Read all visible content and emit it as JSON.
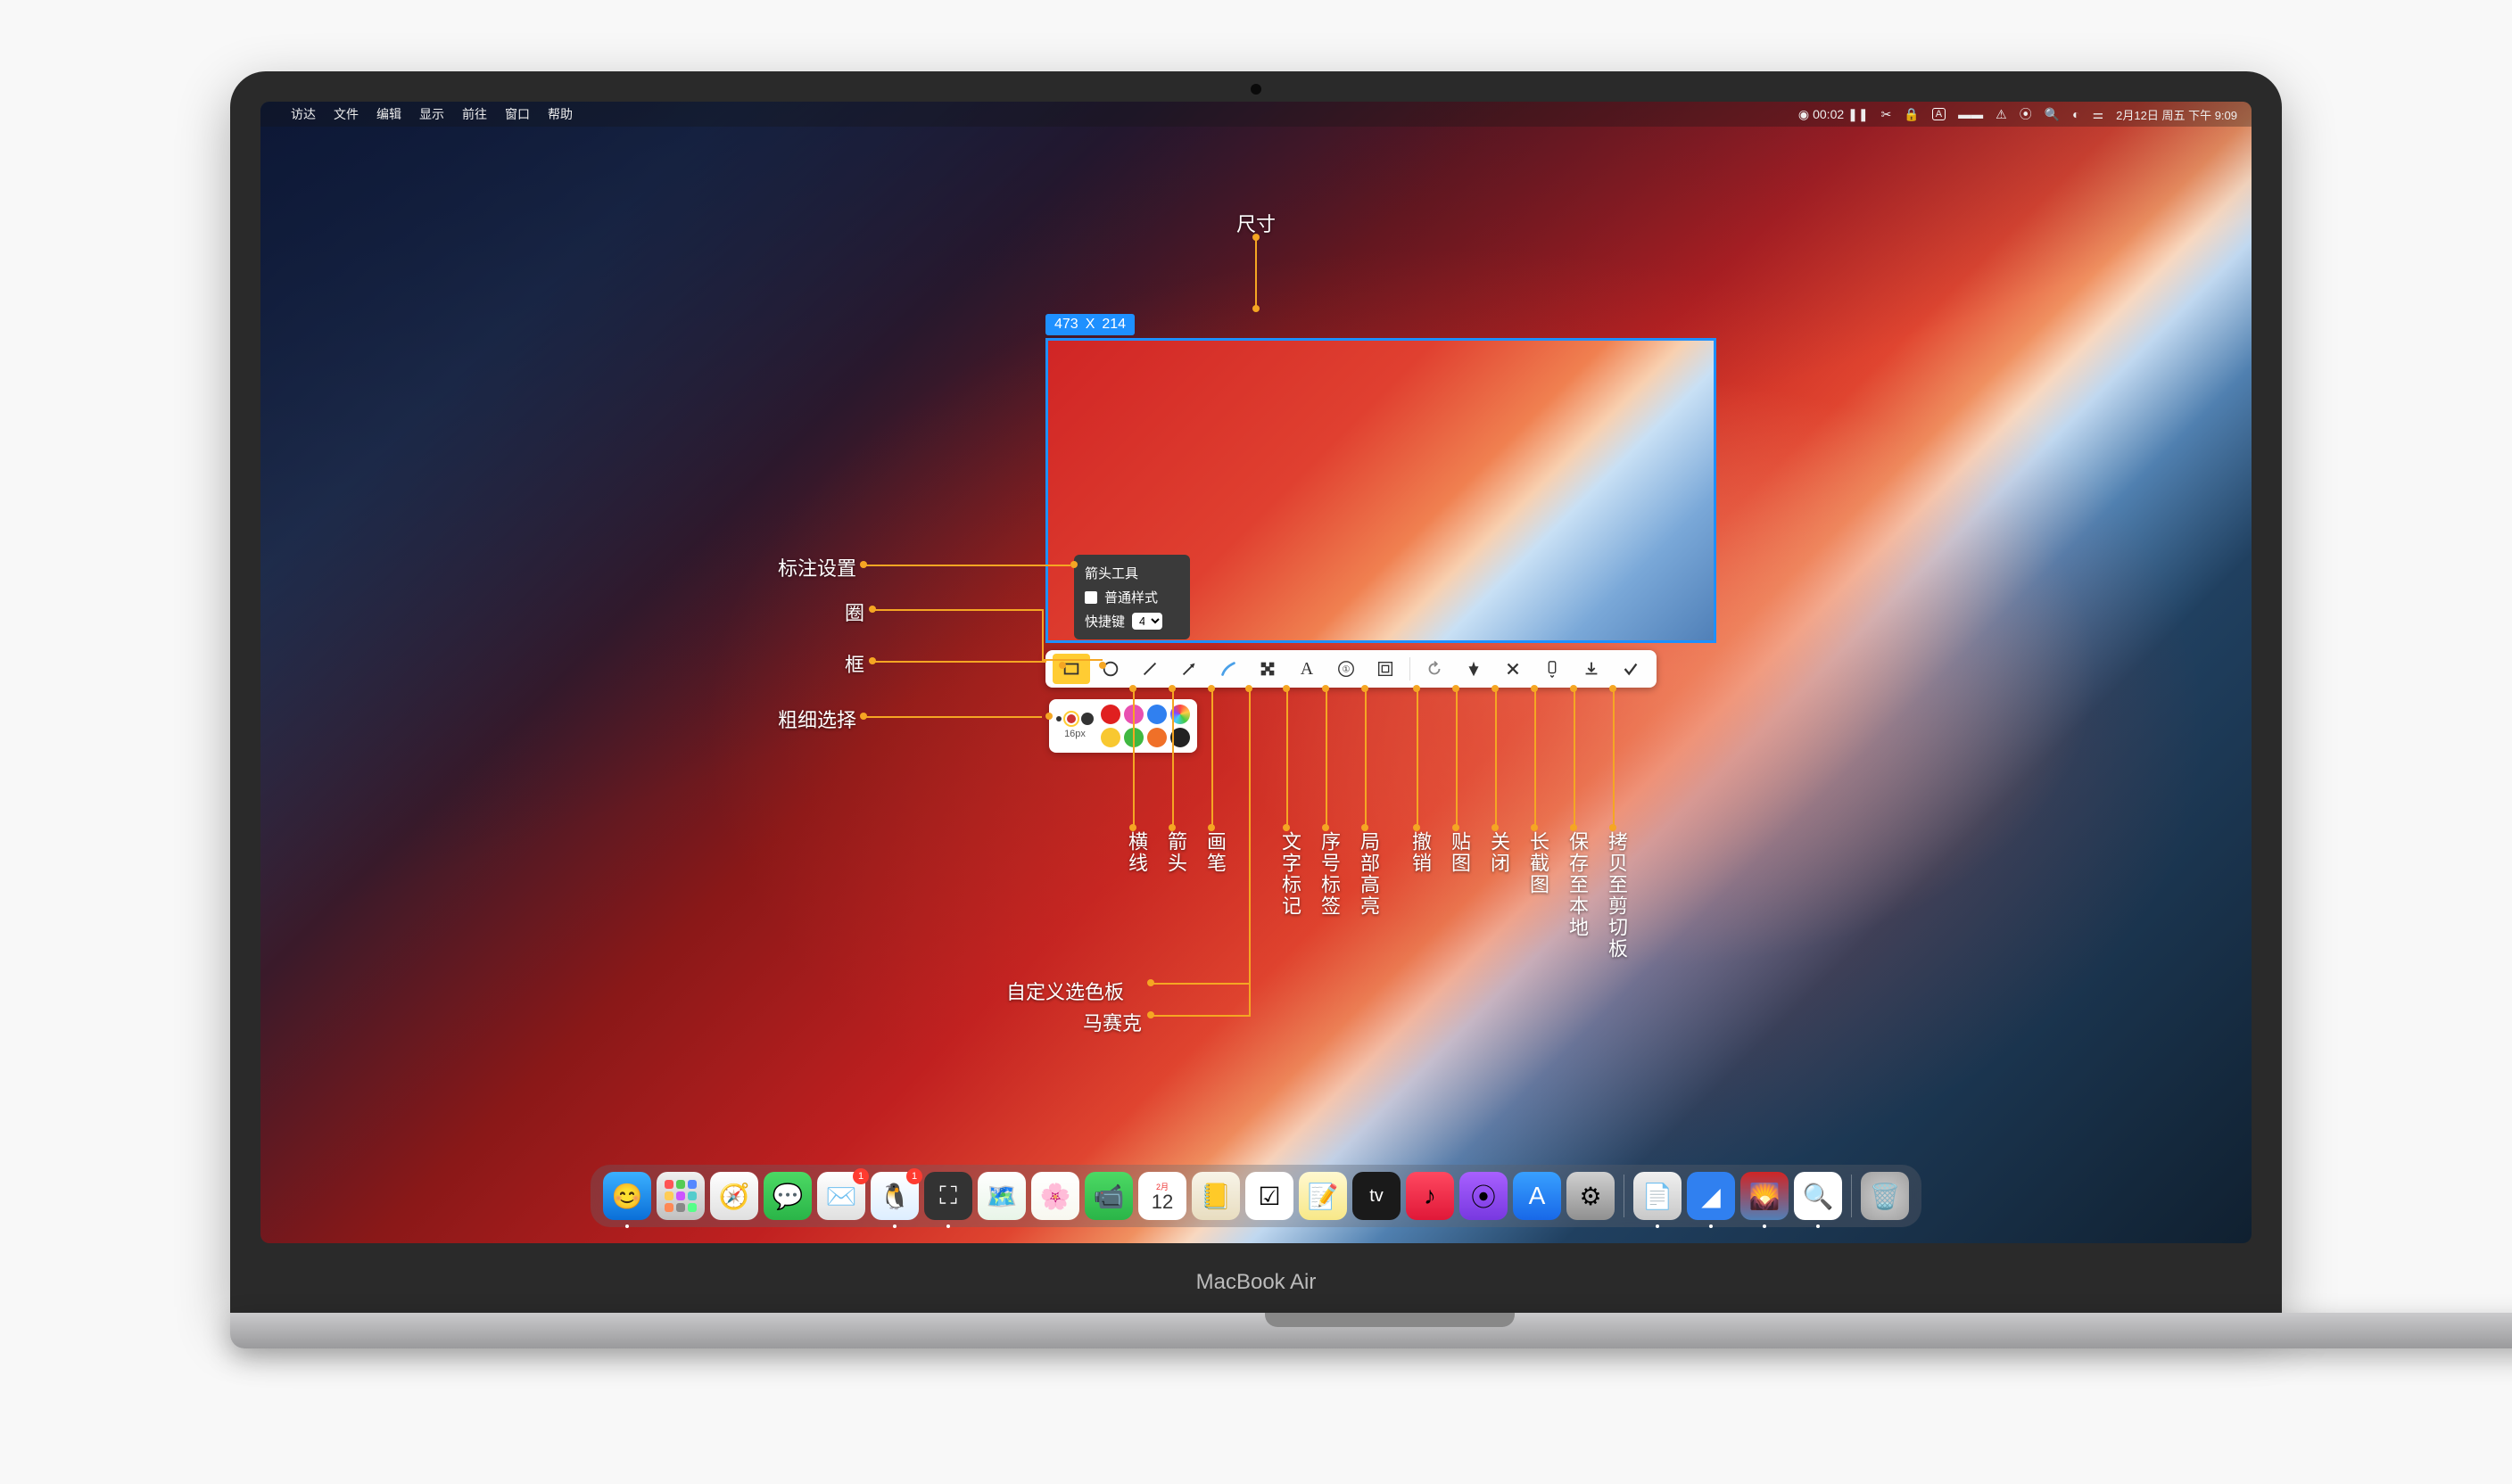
{
  "device": {
    "brand": "MacBook Air"
  },
  "menubar": {
    "items": [
      "访达",
      "文件",
      "编辑",
      "显示",
      "前往",
      "窗口",
      "帮助"
    ],
    "timer": "00:02",
    "clock": "2月12日 周五 下午 9:09"
  },
  "dim_label": "尺寸",
  "dim_badge": {
    "w": "473",
    "x": "X",
    "h": "214"
  },
  "tooltip": {
    "title": "箭头工具",
    "style": "普通样式",
    "hotkey_label": "快捷键",
    "hotkey_value": "4"
  },
  "style_panel": {
    "size_text": "16px"
  },
  "annotations": {
    "left": {
      "settings": "标注设置",
      "circle": "圈",
      "rect": "框",
      "width": "粗细选择"
    },
    "bottom": {
      "line": "横线",
      "arrow": "箭头",
      "brush": "画笔",
      "mosaic": "马赛克",
      "palette": "自定义选色板",
      "text": "文字标记",
      "number": "序号标签",
      "highlight": "局部高亮",
      "undo": "撤销",
      "pin": "贴图",
      "close": "关闭",
      "long": "长截图",
      "save": "保存至本地",
      "copy": "拷贝至剪切板"
    }
  },
  "dock": {
    "cal_month": "2月",
    "cal_day": "12",
    "tv": "tv",
    "badges": {
      "qq": "1",
      "mail": "1"
    }
  }
}
